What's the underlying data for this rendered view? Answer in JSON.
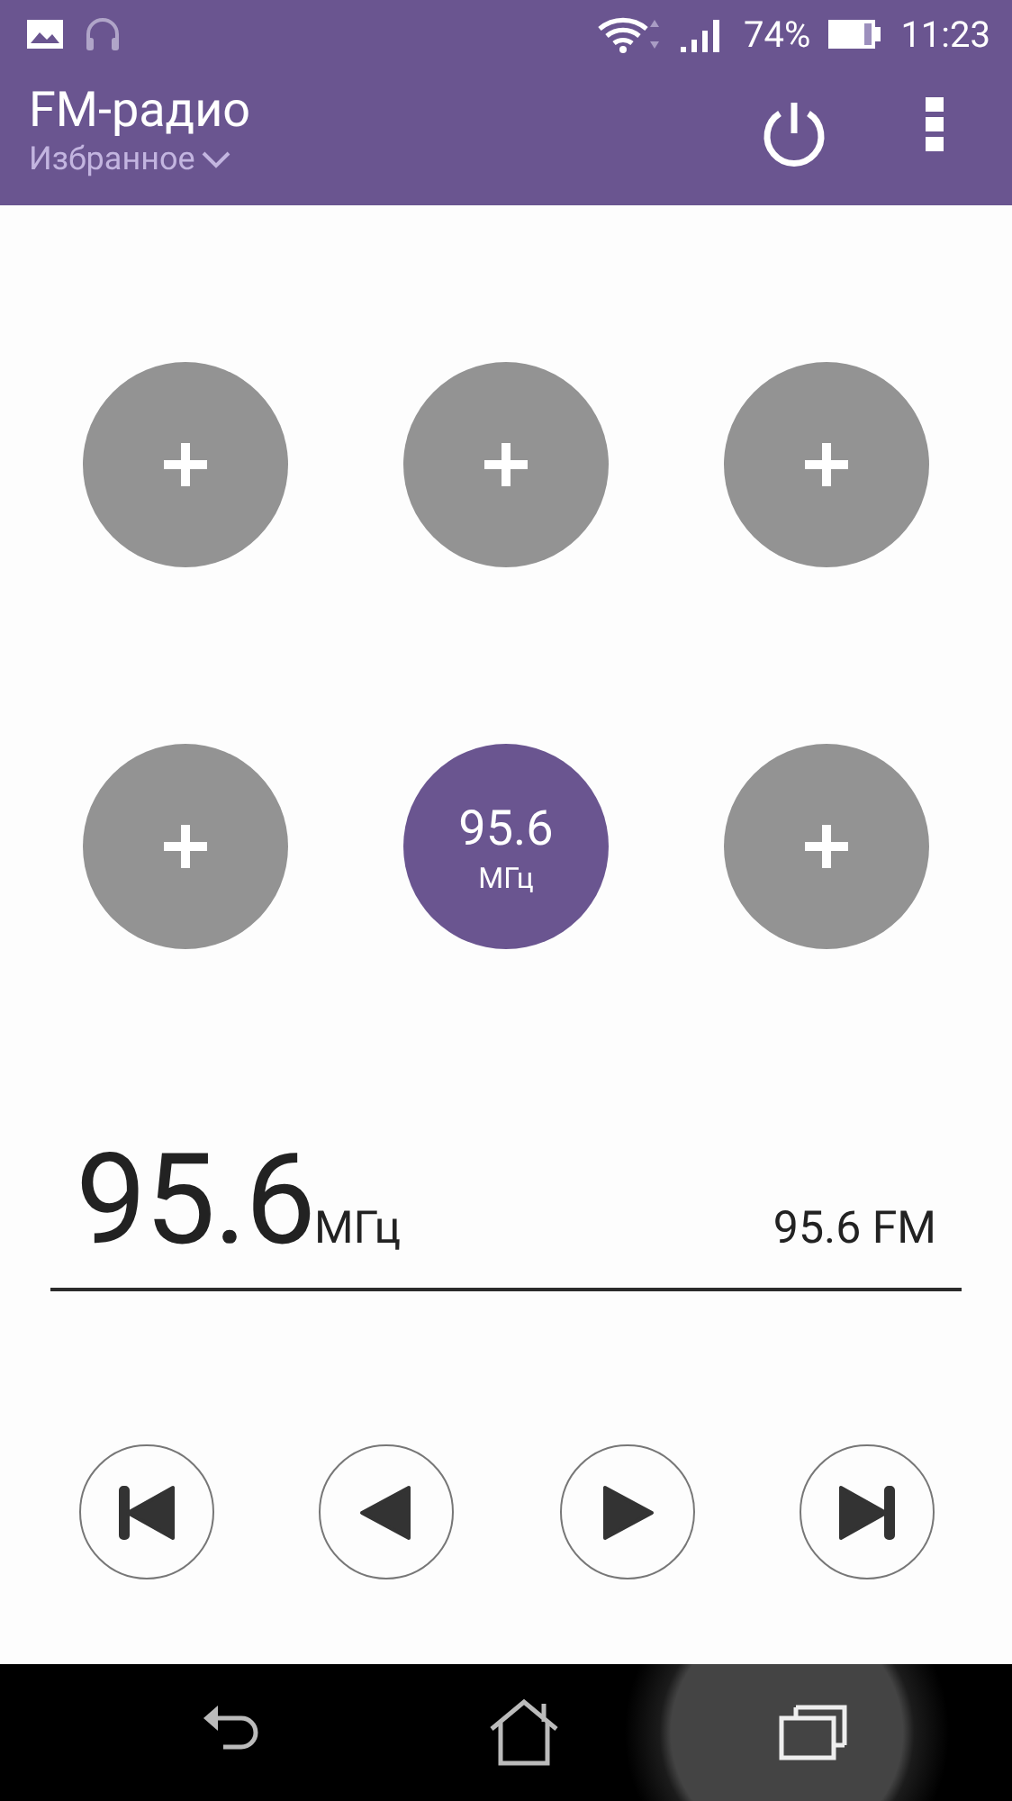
{
  "status_bar": {
    "battery": "74%",
    "time": "11:23"
  },
  "app_bar": {
    "title": "FM-радио",
    "subtitle": "Избранное"
  },
  "presets": [
    {
      "kind": "empty",
      "selected": false
    },
    {
      "kind": "empty",
      "selected": false
    },
    {
      "kind": "empty",
      "selected": false
    },
    {
      "kind": "empty",
      "selected": false
    },
    {
      "kind": "station",
      "frequency": "95.6",
      "unit": "МГц",
      "selected": true
    },
    {
      "kind": "empty",
      "selected": false
    }
  ],
  "tuner": {
    "frequency": "95.6",
    "unit": "МГц",
    "station": "95.6 FM"
  },
  "controls": [
    {
      "kind": "skip-back"
    },
    {
      "kind": "seek-back"
    },
    {
      "kind": "seek-forward"
    },
    {
      "kind": "skip-forward"
    }
  ]
}
